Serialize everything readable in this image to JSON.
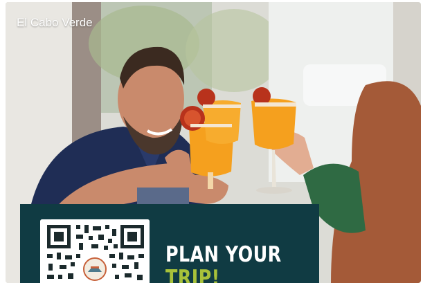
{
  "caption": "El Cabo Verde",
  "promo": {
    "headline_line1": "PLAN YOUR",
    "headline_line2": "TRIP!"
  },
  "colors": {
    "panel": "#103b43",
    "headline": "#ffffff",
    "accent": "#a8c23a",
    "drink": "#f5a01e"
  },
  "icons": [
    "qr-code-icon",
    "logo-badge-icon"
  ]
}
